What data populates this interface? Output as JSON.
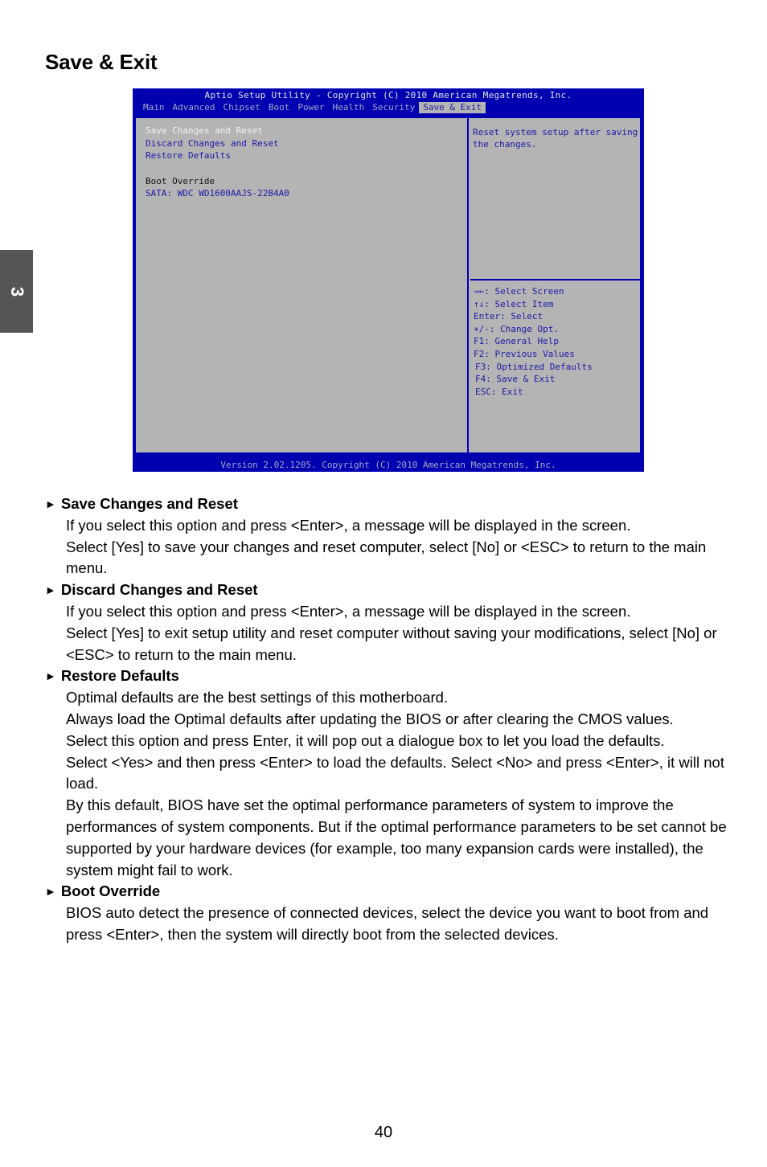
{
  "page": {
    "title": "Save & Exit",
    "chapter": "3",
    "page_number": "40"
  },
  "bios": {
    "title": "Aptio Setup Utility - Copyright (C) 2010 American Megatrends, Inc.",
    "tabs": [
      {
        "label": "Main"
      },
      {
        "label": "Advanced"
      },
      {
        "label": "Chipset"
      },
      {
        "label": "Boot"
      },
      {
        "label": "Power"
      },
      {
        "label": "Health"
      },
      {
        "label": "Security"
      },
      {
        "label": "Save & Exit",
        "active": true
      }
    ],
    "items": [
      {
        "label": "Save Changes and Reset",
        "state": "selected"
      },
      {
        "label": "Discard Changes and Reset",
        "state": "option"
      },
      {
        "label": "Restore Defaults",
        "state": "option"
      },
      {
        "label": "Boot Override",
        "state": "header"
      },
      {
        "label": "SATA: WDC WD1600AAJS-22B4A0",
        "state": "option"
      }
    ],
    "help_text": "Reset system setup after saving the changes.",
    "keys": [
      "→←: Select Screen",
      "↑↓: Select Item",
      "Enter: Select",
      "+/-: Change Opt.",
      "F1: General Help",
      "F2: Previous Values",
      "F3: Optimized Defaults",
      "F4: Save & Exit",
      "ESC: Exit"
    ],
    "footer": "Version 2.02.1205. Copyright (C) 2010 American Megatrends, Inc.",
    "colors": {
      "frame": "#0000b0",
      "panel": "#b4b4b4",
      "text_blue": "#1a1aa8",
      "text_selected": "#f0f0f0"
    }
  },
  "sections": [
    {
      "heading": "Save Changes and Reset",
      "lines": [
        "If you select this option and press <Enter>, a message will be displayed in the screen.",
        "Select [Yes] to save your changes and reset computer, select [No] or <ESC> to return to the main menu."
      ]
    },
    {
      "heading": "Discard Changes and Reset",
      "lines": [
        "If you select this option and press <Enter>,  a message will be displayed in the screen.",
        "Select [Yes] to exit setup utility and reset computer without saving your modifications, select [No] or <ESC> to return to the main menu."
      ]
    },
    {
      "heading": "Restore Defaults",
      "lines": [
        "Optimal defaults are the best settings of this motherboard.",
        "Always load the Optimal defaults after updating the BIOS or after clearing the CMOS values.",
        "Select this option and press Enter, it will pop out a dialogue box to let you load the defaults.",
        "Select <Yes> and then press <Enter> to load the defaults. Select <No> and press <Enter>, it will not load.",
        "By this default, BIOS have set the optimal performance parameters of system to improve the performances of system components. But if the optimal performance parameters to be set cannot be supported by your hardware devices (for example, too many expansion cards were installed), the system might fail to work."
      ]
    },
    {
      "heading": "Boot Override",
      "lines": [
        "BIOS auto detect the presence of connected devices, select the device you want to boot from and press <Enter>, then the system will directly boot from the selected devices."
      ]
    }
  ],
  "bullet_glyph": "►"
}
